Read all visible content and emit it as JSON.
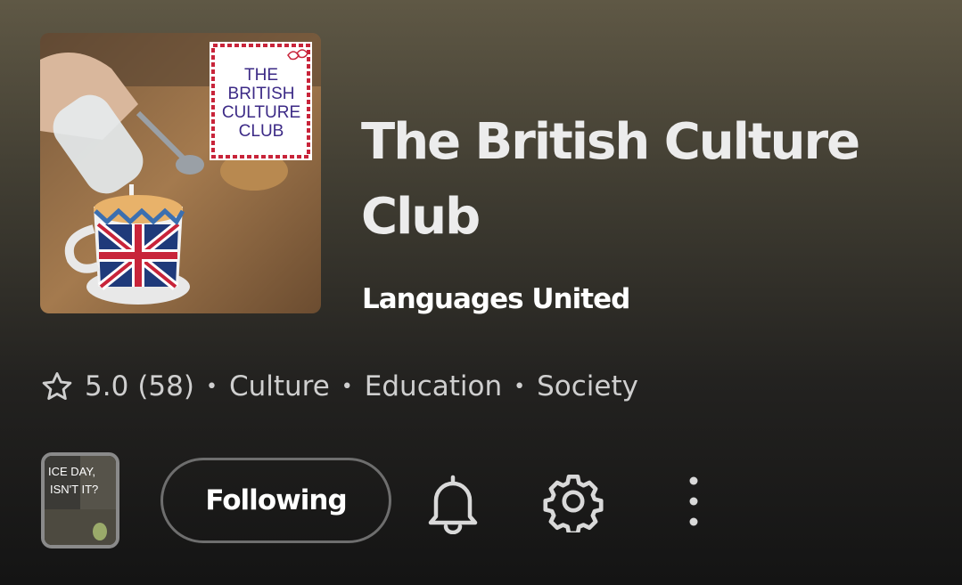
{
  "podcast": {
    "title": "The British Culture Club",
    "author": "Languages United",
    "cover_text": [
      "THE",
      "BRITISH",
      "CULTURE",
      "CLUB"
    ]
  },
  "meta": {
    "rating": "5.0",
    "rating_count": "(58)",
    "categories": [
      "Culture",
      "Education",
      "Society"
    ],
    "separator": "•"
  },
  "episode_thumb_text": [
    "ICE DAY,",
    "ISN'T IT?"
  ],
  "actions": {
    "following_label": "Following",
    "icons": [
      "bell-icon",
      "gear-icon",
      "more-vertical-icon"
    ]
  },
  "colors": {
    "cover_frame": "#c8243a",
    "cover_text": "#3c2a86",
    "button_border": "#6e6e6e"
  }
}
